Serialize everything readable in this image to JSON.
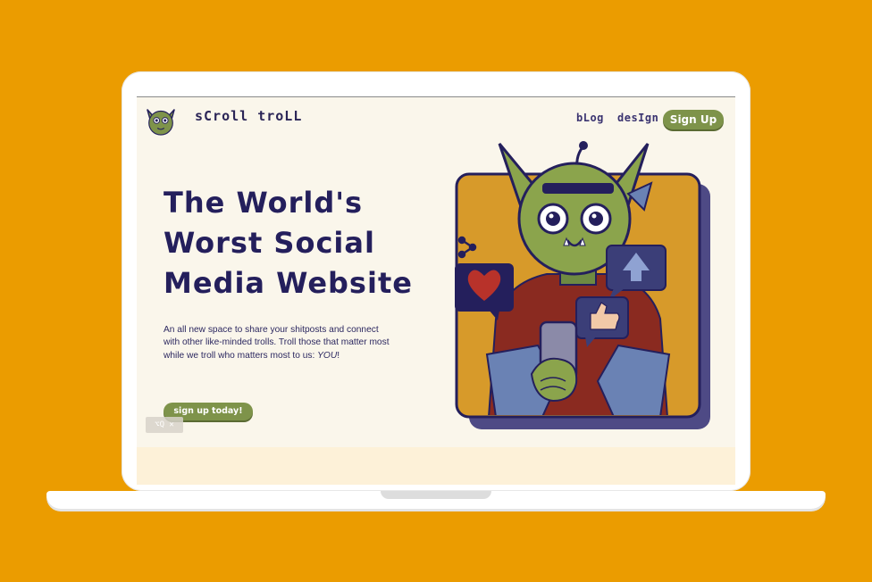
{
  "colors": {
    "background": "#EB9C00",
    "accent_green": "#7E934A",
    "navy": "#241F5C",
    "screen_bg": "#FAF6EB"
  },
  "header": {
    "logo_icon": "goblin-logo-icon",
    "brand": "sCroll troLL",
    "nav": {
      "blog": "bLog",
      "design": "desIgn",
      "signup": "Sign Up"
    }
  },
  "hero": {
    "title_lines": [
      "The World's",
      "Worst Social",
      "Media Website"
    ],
    "description_pre": "An all new space to share your shitposts and connect with other like-minded trolls. Troll those that matter most while we troll who matters most to us: ",
    "description_em": "YOU",
    "description_post": "!",
    "cta": "sign up today!",
    "illustration_icon": "goblin-with-phone-illustration"
  }
}
